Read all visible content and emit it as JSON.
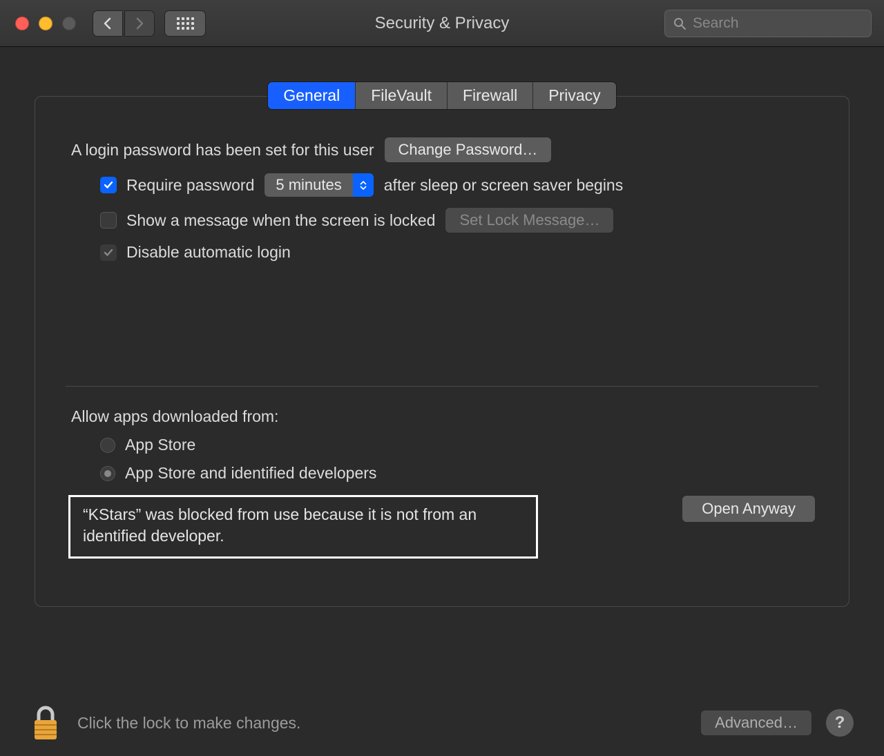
{
  "window": {
    "title": "Security & Privacy"
  },
  "search": {
    "placeholder": "Search"
  },
  "tabs": [
    {
      "label": "General",
      "active": true
    },
    {
      "label": "FileVault",
      "active": false
    },
    {
      "label": "Firewall",
      "active": false
    },
    {
      "label": "Privacy",
      "active": false
    }
  ],
  "general": {
    "login_password_set_label": "A login password has been set for this user",
    "change_password_label": "Change Password…",
    "require_password_checkbox_checked": true,
    "require_password_label_before": "Require password",
    "require_password_delay": "5 minutes",
    "require_password_label_after": "after sleep or screen saver begins",
    "show_lock_message_checked": false,
    "show_lock_message_label": "Show a message when the screen is locked",
    "set_lock_message_label": "Set Lock Message…",
    "disable_auto_login_checked": true,
    "disable_auto_login_label": "Disable automatic login"
  },
  "gatekeeper": {
    "allow_label": "Allow apps downloaded from:",
    "options": [
      {
        "label": "App Store",
        "selected": false
      },
      {
        "label": "App Store and identified developers",
        "selected": true
      }
    ],
    "blocked_message": "“KStars” was blocked from use because it is not from an identified developer.",
    "open_anyway_label": "Open Anyway"
  },
  "footer": {
    "lock_hint": "Click the lock to make changes.",
    "advanced_label": "Advanced…",
    "help_label": "?"
  }
}
